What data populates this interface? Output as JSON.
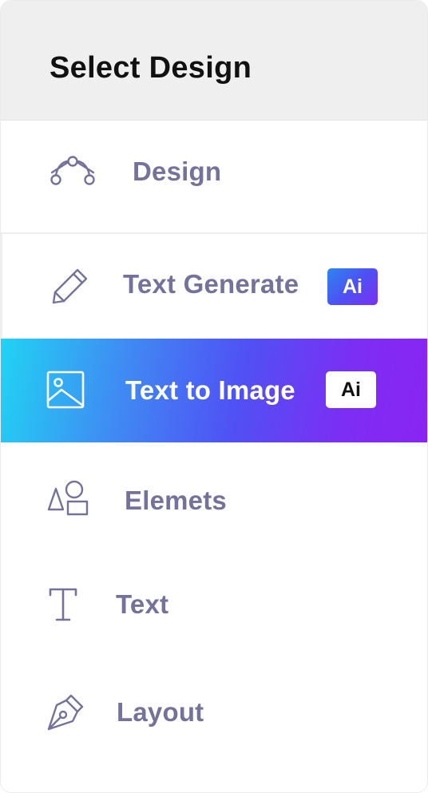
{
  "header": {
    "title": "Select Design"
  },
  "menu": {
    "design": {
      "label": "Design",
      "icon": "bezier-curve-icon"
    },
    "text_generate": {
      "label": "Text Generate",
      "icon": "pencil-icon",
      "badge": "Ai"
    },
    "text_to_image": {
      "label": "Text to Image",
      "icon": "image-icon",
      "badge": "Ai",
      "active": true
    },
    "elements": {
      "label": "Elemets",
      "icon": "shapes-icon"
    },
    "text": {
      "label": "Text",
      "icon": "text-t-icon"
    },
    "layout": {
      "label": "Layout",
      "icon": "pen-nib-icon"
    }
  },
  "colors": {
    "label": "#74729a",
    "header_bg": "#efefef",
    "active_gradient_start": "#21d3f3",
    "active_gradient_end": "#8b24f3",
    "badge_gradient_start": "#2a86f0",
    "badge_gradient_end": "#7b2ff2"
  }
}
